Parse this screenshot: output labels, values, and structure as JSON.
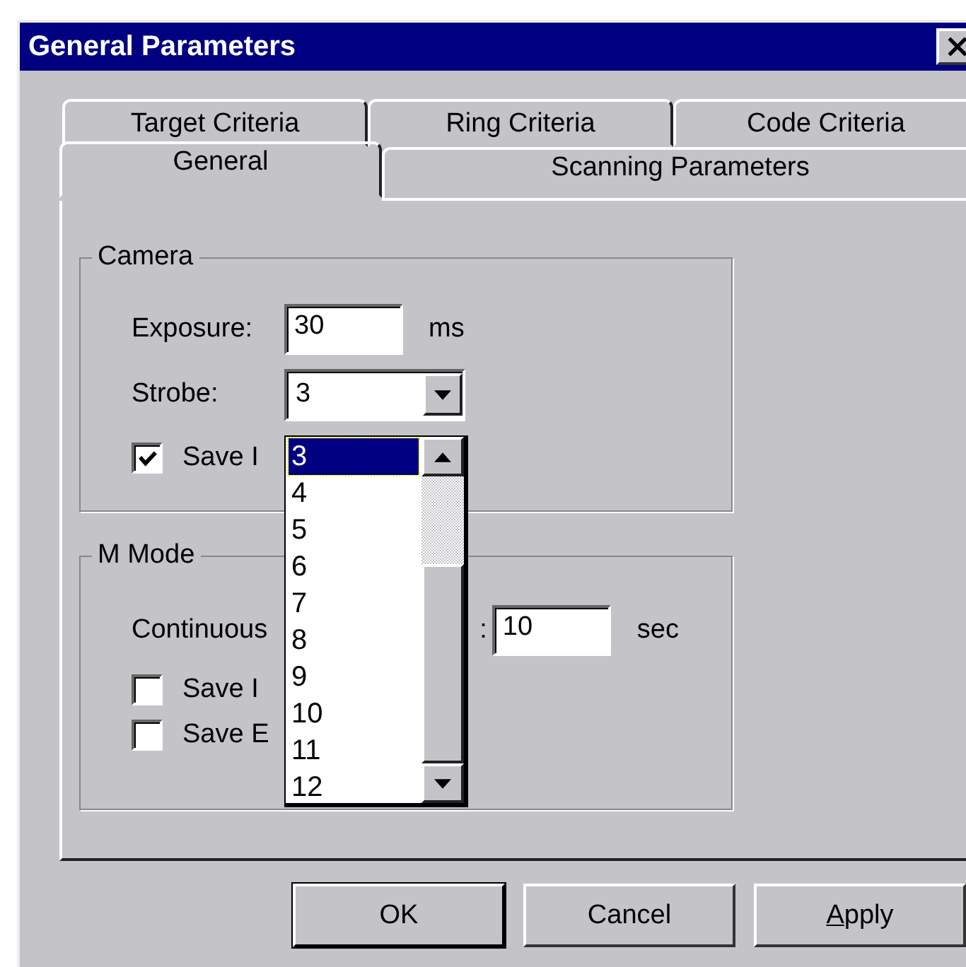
{
  "window": {
    "title": "General Parameters"
  },
  "tab_rows": [
    [
      {
        "label": "Target Criteria",
        "selected": false
      },
      {
        "label": "Ring Criteria",
        "selected": false
      },
      {
        "label": "Code Criteria",
        "selected": false
      }
    ],
    [
      {
        "label": "General",
        "selected": true
      },
      {
        "label": "Scanning Parameters",
        "selected": false
      }
    ]
  ],
  "camera": {
    "title": "Camera",
    "exposure_label": "Exposure:",
    "exposure_value": "30",
    "exposure_unit": "ms",
    "strobe_label": "Strobe:",
    "strobe_value": "3",
    "checkbox": {
      "label": "Save I",
      "checked": true
    }
  },
  "strobe_list": {
    "items": [
      {
        "label": "3",
        "selected": true
      },
      {
        "label": "4",
        "selected": false
      },
      {
        "label": "5",
        "selected": false
      },
      {
        "label": "6",
        "selected": false
      },
      {
        "label": "7",
        "selected": false
      },
      {
        "label": "8",
        "selected": false
      },
      {
        "label": "9",
        "selected": false
      },
      {
        "label": "10",
        "selected": false
      },
      {
        "label": "11",
        "selected": false
      },
      {
        "label": "12",
        "selected": false
      }
    ]
  },
  "m_mode": {
    "title": "M Mode",
    "continuous_label": "Continuous",
    "continuous_label_end": ":",
    "continuous_value": "10",
    "continuous_unit": "sec",
    "checkboxes": [
      {
        "label": "Save I",
        "checked": false
      },
      {
        "label": "Save E",
        "checked": false
      }
    ]
  },
  "buttons": [
    {
      "label": "OK",
      "default": true,
      "underline_first": false
    },
    {
      "label": "Cancel",
      "default": false,
      "underline_first": false
    },
    {
      "label": "Apply",
      "default": false,
      "underline_first": true
    }
  ]
}
